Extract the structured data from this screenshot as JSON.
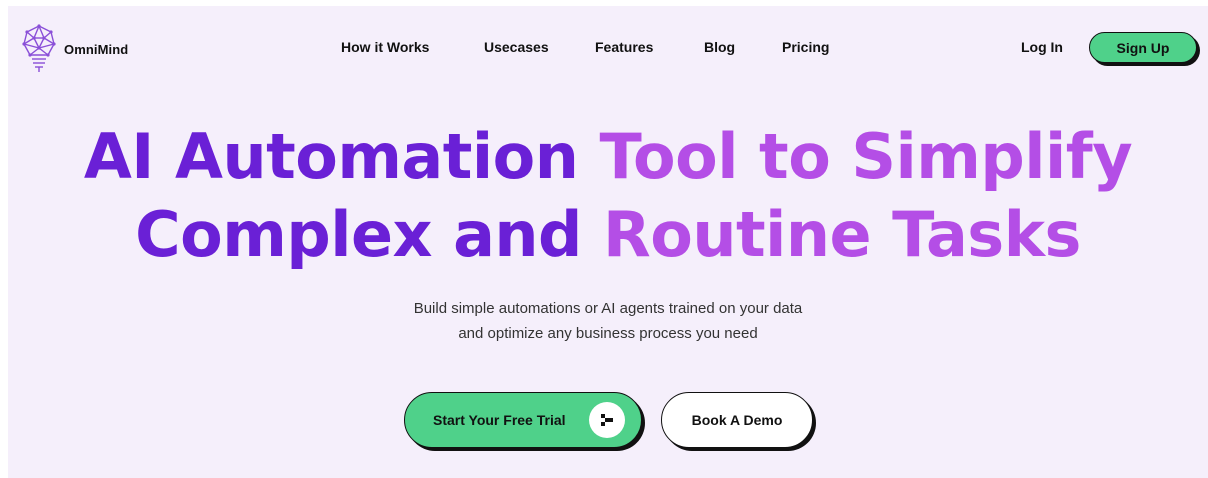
{
  "brand": {
    "name": "OmniMind",
    "logo_icon": "lightbulb-network-icon"
  },
  "nav": {
    "items": [
      {
        "label": "How it Works"
      },
      {
        "label": "Usecases"
      },
      {
        "label": "Features"
      },
      {
        "label": "Blog"
      },
      {
        "label": "Pricing"
      }
    ],
    "login_label": "Log In",
    "signup_label": "Sign Up"
  },
  "hero": {
    "title_line1_dark": "AI Automation ",
    "title_line1_light": "Tool to Simplify",
    "title_line2_dark": "Complex and ",
    "title_line2_light": "Routine Tasks",
    "subtitle_line1": "Build simple automations or AI agents trained on your data",
    "subtitle_line2": "and optimize any business process you need"
  },
  "cta": {
    "trial_label": "Start Your Free Trial",
    "trial_icon": "pixel-arrow-icon",
    "demo_label": "Book A Demo"
  },
  "colors": {
    "background": "#f5effb",
    "accent_green": "#4fd18a",
    "title_dark": "#6a20d6",
    "title_light": "#b44ee6",
    "logo_purple": "#8a4fd8"
  }
}
